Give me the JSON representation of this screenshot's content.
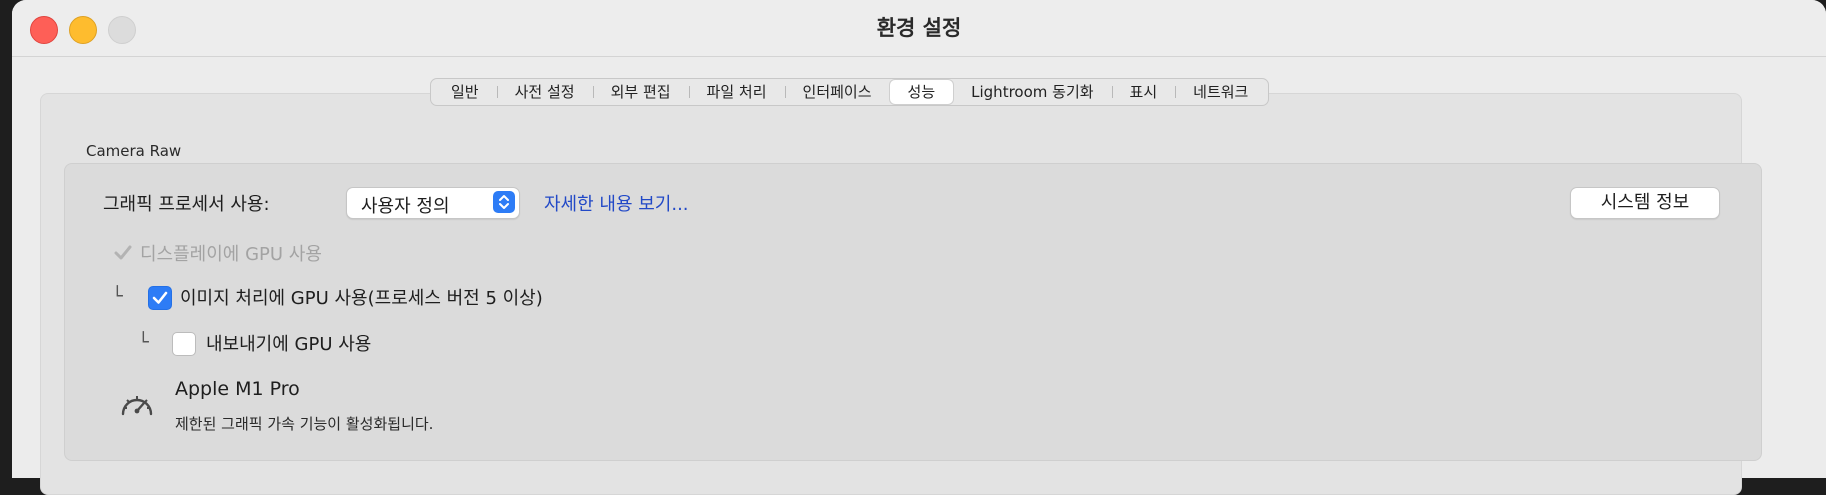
{
  "window": {
    "title": "환경 설정"
  },
  "tabs": [
    {
      "label": "일반",
      "active": false
    },
    {
      "label": "사전 설정",
      "active": false
    },
    {
      "label": "외부 편집",
      "active": false
    },
    {
      "label": "파일 처리",
      "active": false
    },
    {
      "label": "인터페이스",
      "active": false
    },
    {
      "label": "성능",
      "active": true
    },
    {
      "label": "Lightroom 동기화",
      "active": false
    },
    {
      "label": "표시",
      "active": false
    },
    {
      "label": "네트워크",
      "active": false
    }
  ],
  "camera_raw": {
    "group_label": "Camera Raw",
    "gpu_label": "그래픽 프로세서 사용:",
    "gpu_select_value": "사용자 정의",
    "details_link": "자세한 내용 보기...",
    "system_info_button": "시스템 정보",
    "opt_display": {
      "label": "디스플레이에 GPU 사용",
      "checked": true,
      "enabled": false
    },
    "opt_image": {
      "label": "이미지 처리에 GPU 사용(프로세스 버전 5 이상)",
      "checked": true,
      "enabled": true
    },
    "opt_export": {
      "label": "내보내기에 GPU 사용",
      "checked": false,
      "enabled": true
    },
    "tree_branch": "└",
    "gpu_name": "Apple M1 Pro",
    "gpu_status": "제한된 그래픽 가속 기능이 활성화됩니다.",
    "status_icon": "speedometer-icon"
  },
  "colors": {
    "accent": "#2d7cf6",
    "link": "#2249c7",
    "close": "#fe5f57",
    "minimize": "#febc2e"
  }
}
